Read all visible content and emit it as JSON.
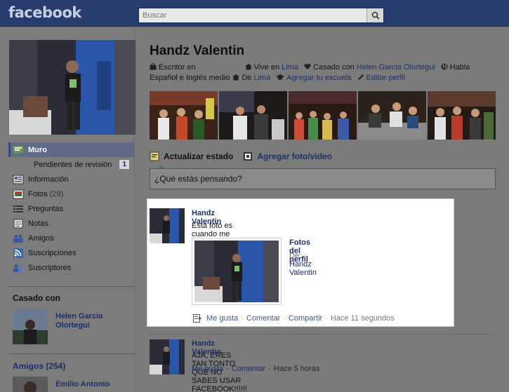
{
  "header": {
    "logo": "facebook",
    "search_placeholder": "Buscar"
  },
  "sidebar": {
    "nav": [
      {
        "label": "Muro",
        "icon": "wall-icon",
        "active": true
      },
      {
        "label": "Pendientes de revisión",
        "badge": "1",
        "sub": true
      },
      {
        "label": "Información",
        "icon": "info-icon"
      },
      {
        "label": "Fotos",
        "count": "(29)",
        "icon": "photos-icon"
      },
      {
        "label": "Preguntas",
        "icon": "questions-icon"
      },
      {
        "label": "Notas",
        "icon": "notes-icon"
      },
      {
        "label": "Amigos",
        "icon": "friends-icon"
      },
      {
        "label": "Suscripciones",
        "icon": "subscriptions-icon"
      },
      {
        "label": "Suscriptores",
        "icon": "subscribers-icon"
      }
    ],
    "married_title": "Casado con",
    "spouse_name": "Helen Garcia Olortegui",
    "friends_title": "Amigos (254)",
    "friend_name": "Emilio Antonio"
  },
  "profile": {
    "name": "Handz Valentin",
    "info": {
      "job": "Escritor en",
      "lives_prefix": "Vive en",
      "lives_city": "Lima",
      "married_prefix": "Casado con",
      "married_name": "Helen Garcia Olortegui",
      "speaks_prefix": "Habla",
      "languages": "Español e Inglés medio",
      "from_prefix": "De",
      "from_city": "Lima",
      "add_school": "Agregar tu escuela",
      "edit_profile": "Editar perfil"
    }
  },
  "composer": {
    "tab_status": "Actualizar estado",
    "tab_photo": "Agregar foto/video",
    "placeholder": "¿Qué estás pensando?"
  },
  "posts": [
    {
      "author": "Handz Valentin",
      "text": "Esta foto es cuando me fui a Ayacucho con el equipo de DASS Productions!!!",
      "attachment_title": "Fotos del perfil",
      "attachment_from_prefix": "De:",
      "attachment_from": "Handz Valentin",
      "like": "Me gusta",
      "comment": "Comentar",
      "share": "Compartir",
      "time": "Hace 11 segundos"
    },
    {
      "author": "Handz Valentin",
      "text": "AJA, ERES TAN TONTO QUE NO SABES USAR FACEBOOK!!!!!!",
      "like": "Me gusta",
      "comment": "Comentar",
      "time": "Hace 5 horas"
    }
  ],
  "colors": {
    "header_bg": "#283c6e",
    "link": "#1e2f6b",
    "highlight_bg": "#ffffff"
  }
}
